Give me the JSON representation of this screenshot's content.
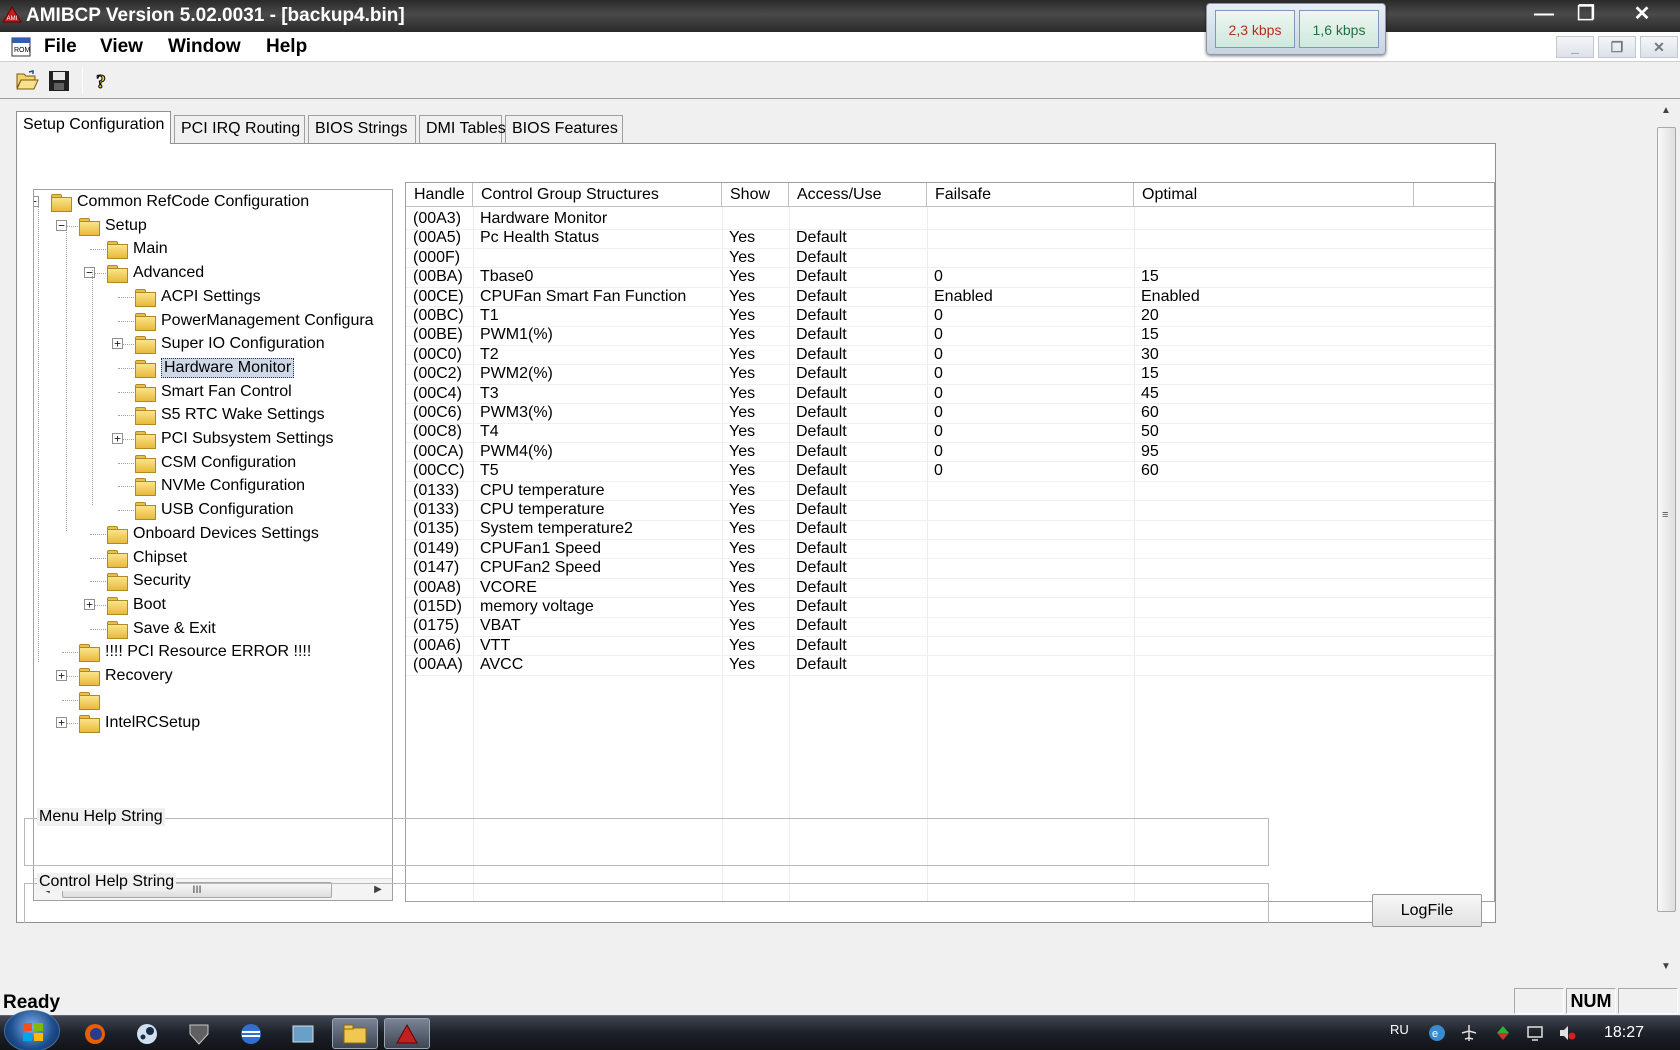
{
  "window": {
    "title": "AMIBCP Version 5.02.0031 - [backup4.bin]",
    "minimize": "—",
    "maximize": "❐",
    "close": "✕"
  },
  "network": {
    "down": "2,3 kbps",
    "up": "1,6 kbps"
  },
  "menu": {
    "file": "File",
    "view": "View",
    "window": "Window",
    "help": "Help"
  },
  "mdi": {
    "minimize": "_",
    "restore": "❐",
    "close": "✕"
  },
  "toolbar": [
    "folder-open-icon",
    "save-icon",
    "help-icon"
  ],
  "tabs": [
    {
      "label": "Setup Configuration",
      "active": true
    },
    {
      "label": "PCI IRQ Routing"
    },
    {
      "label": "BIOS Strings"
    },
    {
      "label": "DMI Tables"
    },
    {
      "label": "BIOS Features"
    }
  ],
  "tree": [
    {
      "label": "Common RefCode Configuration",
      "level": 0,
      "expander": "−"
    },
    {
      "label": "Setup",
      "level": 1,
      "expander": "−"
    },
    {
      "label": "Main",
      "level": 2
    },
    {
      "label": "Advanced",
      "level": 2,
      "expander": "−"
    },
    {
      "label": "ACPI Settings",
      "level": 3
    },
    {
      "label": "PowerManagement Configura",
      "level": 3
    },
    {
      "label": "Super IO Configuration",
      "level": 3,
      "expander": "+"
    },
    {
      "label": "Hardware Monitor",
      "level": 3,
      "selected": true
    },
    {
      "label": "Smart Fan Control",
      "level": 3
    },
    {
      "label": "S5 RTC Wake Settings",
      "level": 3
    },
    {
      "label": "PCI Subsystem Settings",
      "level": 3,
      "expander": "+"
    },
    {
      "label": "CSM Configuration",
      "level": 3
    },
    {
      "label": "NVMe Configuration",
      "level": 3
    },
    {
      "label": "USB Configuration",
      "level": 3
    },
    {
      "label": "Onboard Devices Settings",
      "level": 2
    },
    {
      "label": "Chipset",
      "level": 2
    },
    {
      "label": "Security",
      "level": 2
    },
    {
      "label": "Boot",
      "level": 2,
      "expander": "+"
    },
    {
      "label": "Save & Exit",
      "level": 2
    },
    {
      "label": "!!!! PCI Resource ERROR !!!!",
      "level": 1
    },
    {
      "label": "Recovery",
      "level": 1,
      "expander": "+"
    },
    {
      "label": "",
      "level": 1
    },
    {
      "label": "IntelRCSetup",
      "level": 1,
      "expander": "+"
    }
  ],
  "tree_scroll": {
    "left": "◀",
    "right": "▶",
    "grip": "III"
  },
  "grid": {
    "columns": [
      "Handle",
      "Control Group Structures",
      "Show",
      "Access/Use",
      "Failsafe",
      "Optimal"
    ],
    "rows": [
      [
        "(00A3)",
        "Hardware Monitor",
        "",
        "",
        "",
        ""
      ],
      [
        "(00A5)",
        "Pc Health Status",
        "Yes",
        "Default",
        "",
        ""
      ],
      [
        "(000F)",
        "",
        "Yes",
        "Default",
        "",
        ""
      ],
      [
        "(00BA)",
        "Tbase0",
        "Yes",
        "Default",
        "0",
        "15"
      ],
      [
        "(00CE)",
        "CPUFan Smart Fan Function",
        "Yes",
        "Default",
        "Enabled",
        "Enabled"
      ],
      [
        "(00BC)",
        "T1",
        "Yes",
        "Default",
        "0",
        "20"
      ],
      [
        "(00BE)",
        "PWM1(%)",
        "Yes",
        "Default",
        "0",
        "15"
      ],
      [
        "(00C0)",
        "T2",
        "Yes",
        "Default",
        "0",
        "30"
      ],
      [
        "(00C2)",
        "PWM2(%)",
        "Yes",
        "Default",
        "0",
        "15"
      ],
      [
        "(00C4)",
        "T3",
        "Yes",
        "Default",
        "0",
        "45"
      ],
      [
        "(00C6)",
        "PWM3(%)",
        "Yes",
        "Default",
        "0",
        "60"
      ],
      [
        "(00C8)",
        "T4",
        "Yes",
        "Default",
        "0",
        "50"
      ],
      [
        "(00CA)",
        "PWM4(%)",
        "Yes",
        "Default",
        "0",
        "95"
      ],
      [
        "(00CC)",
        "T5",
        "Yes",
        "Default",
        "0",
        "60"
      ],
      [
        "(0133)",
        "CPU temperature",
        "Yes",
        "Default",
        "",
        ""
      ],
      [
        "(0133)",
        "CPU temperature",
        "Yes",
        "Default",
        "",
        ""
      ],
      [
        "(0135)",
        "System temperature2",
        "Yes",
        "Default",
        "",
        ""
      ],
      [
        "(0149)",
        "CPUFan1 Speed",
        "Yes",
        "Default",
        "",
        ""
      ],
      [
        "(0147)",
        "CPUFan2 Speed",
        "Yes",
        "Default",
        "",
        ""
      ],
      [
        "(00A8)",
        "VCORE",
        "Yes",
        "Default",
        "",
        ""
      ],
      [
        "(015D)",
        "memory voltage",
        "Yes",
        "Default",
        "",
        ""
      ],
      [
        "(0175)",
        "VBAT",
        "Yes",
        "Default",
        "",
        ""
      ],
      [
        "(00A6)",
        "VTT",
        "Yes",
        "Default",
        "",
        ""
      ],
      [
        "(00AA)",
        "AVCC",
        "Yes",
        "Default",
        "",
        ""
      ]
    ]
  },
  "help": {
    "menu_label": "Menu Help String",
    "control_label": "Control Help String",
    "logfile": "LogFile"
  },
  "vscroll": {
    "up": "▲",
    "down": "▼",
    "grip": "≡"
  },
  "status": {
    "text": "Ready",
    "num": "NUM"
  },
  "taskbar": {
    "apps": [
      "firefox-icon",
      "steam-icon",
      "world-of-tanks-icon",
      "browser-icon",
      "terminal-icon",
      "explorer-icon",
      "amibcp-icon"
    ],
    "lang": "RU",
    "clock": "18:27"
  },
  "colors": {
    "titlebar": "#2a2a2a",
    "selection": "#cfd8e6",
    "folder": "#f0c850"
  }
}
